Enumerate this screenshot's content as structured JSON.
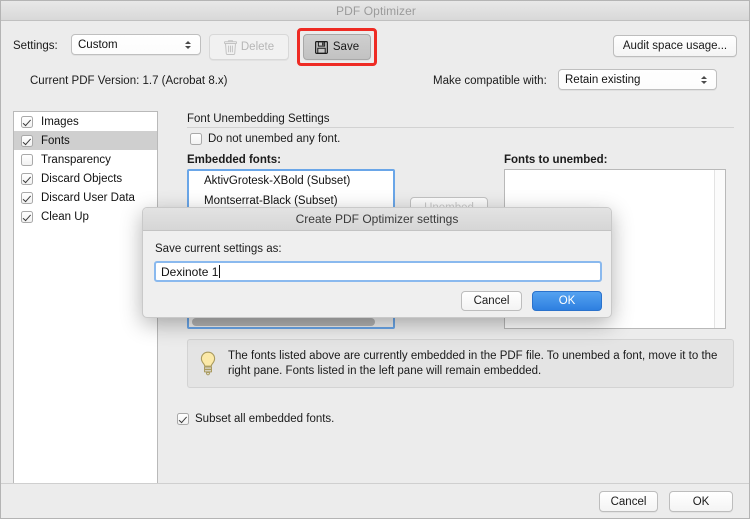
{
  "window": {
    "title": "PDF Optimizer"
  },
  "toolbar": {
    "settings_label": "Settings:",
    "settings_value": "Custom",
    "delete_label": "Delete",
    "save_label": "Save",
    "audit_label": "Audit space usage...",
    "highlight_color": "#ee2b24"
  },
  "info": {
    "pdf_version": "Current PDF Version: 1.7 (Acrobat 8.x)",
    "compatible_label": "Make compatible with:",
    "compatible_value": "Retain existing"
  },
  "sidebar": {
    "items": [
      {
        "label": "Images",
        "checked": true,
        "selected": false
      },
      {
        "label": "Fonts",
        "checked": true,
        "selected": true
      },
      {
        "label": "Transparency",
        "checked": false,
        "selected": false
      },
      {
        "label": "Discard Objects",
        "checked": true,
        "selected": false
      },
      {
        "label": "Discard User Data",
        "checked": true,
        "selected": false
      },
      {
        "label": "Clean Up",
        "checked": true,
        "selected": false
      }
    ]
  },
  "panel": {
    "title": "Font Unembedding Settings",
    "do_not_unembed_label": "Do not unembed any font.",
    "do_not_unembed_checked": false,
    "embedded_label": "Embedded fonts:",
    "unembed_label": "Fonts to unembed:",
    "embedded_fonts": [
      "AktivGrotesk-XBold (Subset)",
      "Montserrat-Black (Subset)"
    ],
    "fonts_to_unembed": [],
    "move_button_label": "Unembed",
    "tip_text": "The fonts listed above are currently embedded in the PDF file. To unembed a font, move it to the right pane. Fonts listed in the left pane will remain embedded.",
    "subset_label": "Subset all embedded fonts.",
    "subset_checked": true
  },
  "footer": {
    "cancel_label": "Cancel",
    "ok_label": "OK"
  },
  "modal": {
    "title": "Create PDF Optimizer settings",
    "prompt": "Save current settings as:",
    "input_value": "Dexinote 1",
    "cancel_label": "Cancel",
    "ok_label": "OK",
    "ok_color": "#2e7fe0"
  }
}
